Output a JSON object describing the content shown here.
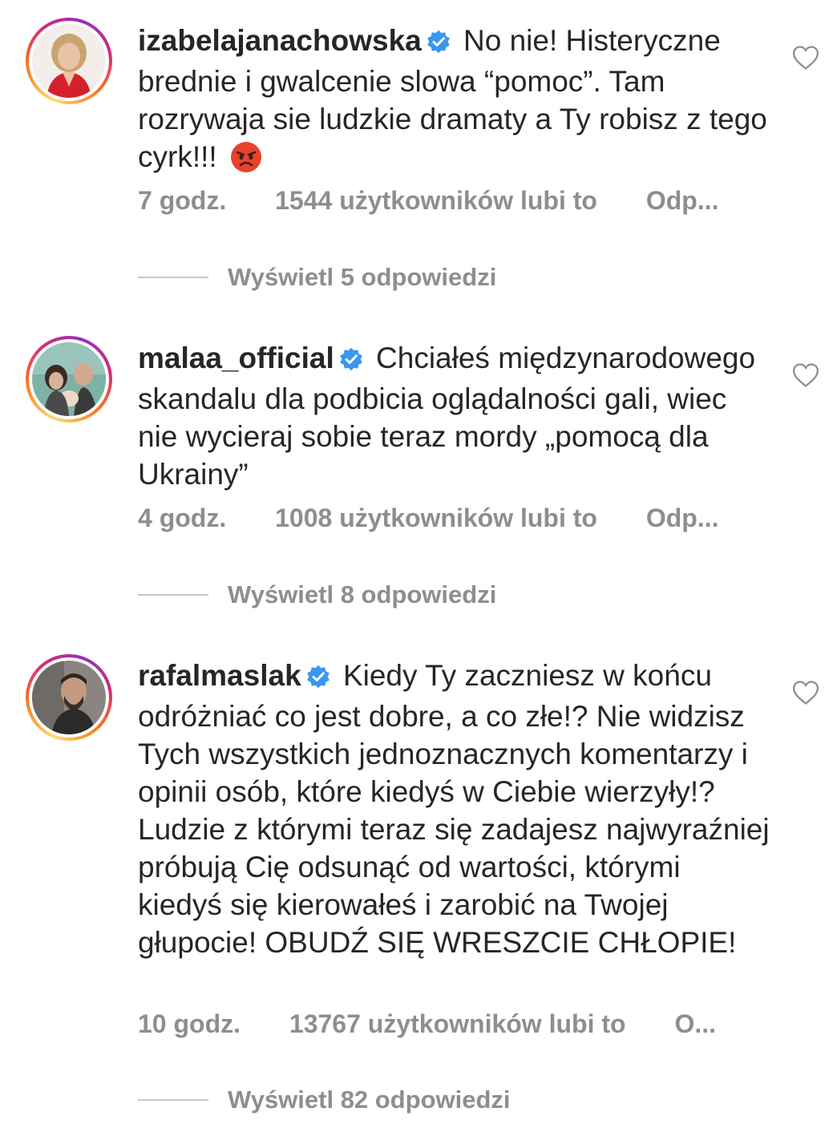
{
  "colors": {
    "text": "#262626",
    "secondary": "#8e8e8e",
    "verified_blue": "#3897f0",
    "divider": "#c7c7c7",
    "angry_emoji": "#e8412c"
  },
  "comments": [
    {
      "username": "izabelajanachowska",
      "verified": true,
      "text": "No nie! Histeryczne bred­nie i gwalcenie slowa “pomoc”. Tam rozrywaja sie ludzkie dramaty a Ty robisz z tego cyrk!!!",
      "emoji": "pouting-face-emoji",
      "time": "7 godz.",
      "likes": "1544 użytkowników lubi to",
      "reply": "Odp...",
      "view_replies": "Wyświetl 5 odpowiedzi"
    },
    {
      "username": "malaa_official",
      "verified": true,
      "text": "Chciałeś międzynarodowego skandalu dla podbicia oglądalności gali, wiec nie wycieraj sobie teraz mordy „pomocą dla Ukrainy”",
      "time": "4 godz.",
      "likes": "1008 użytkowników lubi to",
      "reply": "Odp...",
      "view_replies": "Wyświetl 8 odpowiedzi"
    },
    {
      "username": "rafalmaslak",
      "verified": true,
      "text": "Kiedy Ty zaczniesz w końcu odróżniać co jest dobre, a co złe!? Nie widzisz Tych wszystkich jednoznacznych komentarzy i opinii osób, które kiedyś w Ciebie wierzyły!? Ludzie z którymi teraz się zadajesz najwyraźniej próbują Cię odsunąć od wartości, którymi kiedyś się kierowałeś i zarobić na Twojej głupocie! OBUDŹ SIĘ WRESZCIE CHŁOPIE!",
      "time": "10 godz.",
      "likes": "13767 użytkowników lubi to",
      "reply": "O...",
      "view_replies": "Wyświetl 82 odpowiedzi"
    }
  ]
}
